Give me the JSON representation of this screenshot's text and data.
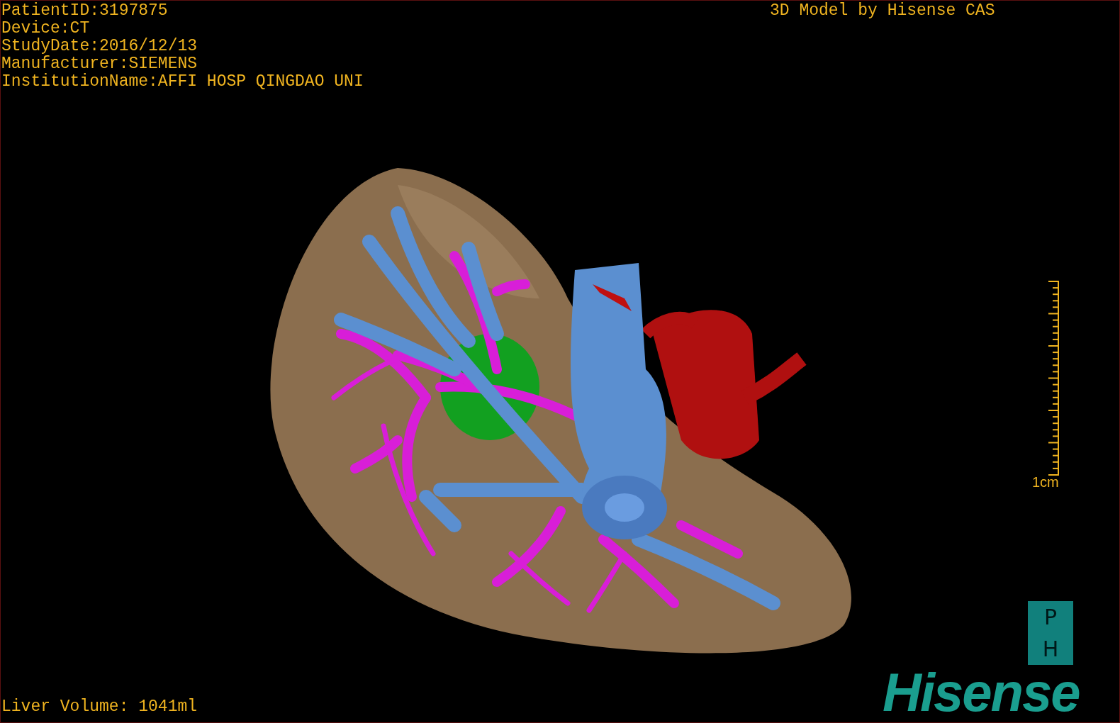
{
  "viewport": {
    "info_lines": [
      "PatientID:3197875",
      "Device:CT",
      "StudyDate:2016/12/13",
      "Manufacturer:SIEMENS",
      "InstitutionName:AFFI HOSP QINGDAO UNI"
    ],
    "title": "3D Model by Hisense CAS",
    "scale_label": "1cm",
    "badge_letters": [
      "P",
      "H"
    ],
    "brand": "Hisense",
    "footer": "Liver Volume: 1041ml"
  }
}
